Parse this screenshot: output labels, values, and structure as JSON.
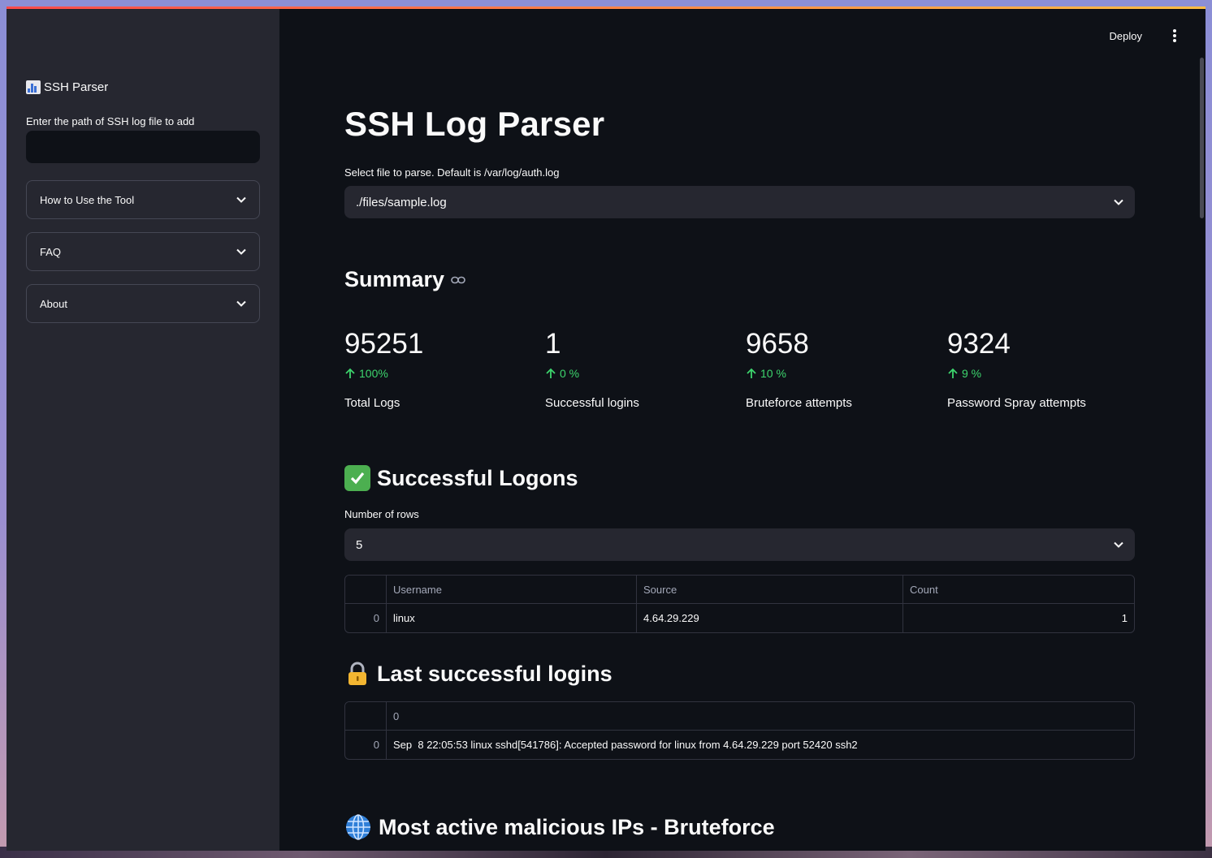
{
  "sidebar": {
    "title": "SSH Parser",
    "input_label": "Enter the path of SSH log file to add",
    "input_value": "",
    "expanders": [
      "How to Use the Tool",
      "FAQ",
      "About"
    ]
  },
  "header": {
    "deploy_label": "Deploy"
  },
  "main": {
    "title": "SSH Log Parser",
    "file_select_label": "Select file to parse. Default is /var/log/auth.log",
    "file_select_value": "./files/sample.log",
    "summary_heading": "Summary",
    "metrics": [
      {
        "value": "95251",
        "delta": "100%",
        "label": "Total Logs"
      },
      {
        "value": "1",
        "delta": "0 %",
        "label": "Successful logins"
      },
      {
        "value": "9658",
        "delta": "10 %",
        "label": "Bruteforce attempts"
      },
      {
        "value": "9324",
        "delta": "9 %",
        "label": "Password Spray attempts"
      }
    ],
    "successful_logons": {
      "heading": "Successful Logons",
      "rows_label": "Number of rows",
      "rows_value": "5",
      "columns": [
        "Username",
        "Source",
        "Count"
      ],
      "rows": [
        {
          "index": "0",
          "username": "linux",
          "source": "4.64.29.229",
          "count": "1"
        }
      ]
    },
    "last_logins": {
      "heading": "Last successful logins",
      "column": "0",
      "rows": [
        {
          "index": "0",
          "text": "Sep  8 22:05:53 linux sshd[541786]: Accepted password for linux from 4.64.29.229 port 52420 ssh2"
        }
      ]
    },
    "bruteforce_heading": "Most active malicious IPs - Bruteforce"
  },
  "colors": {
    "accent_delta": "#3dd56d",
    "sidebar_bg": "#262730",
    "main_bg": "#0e1117"
  },
  "icons": [
    "bar-chart-icon",
    "chevron-down-icon",
    "link-icon",
    "arrow-up-icon",
    "check-mark-icon",
    "lock-icon",
    "globe-icon",
    "kebab-menu-icon"
  ]
}
